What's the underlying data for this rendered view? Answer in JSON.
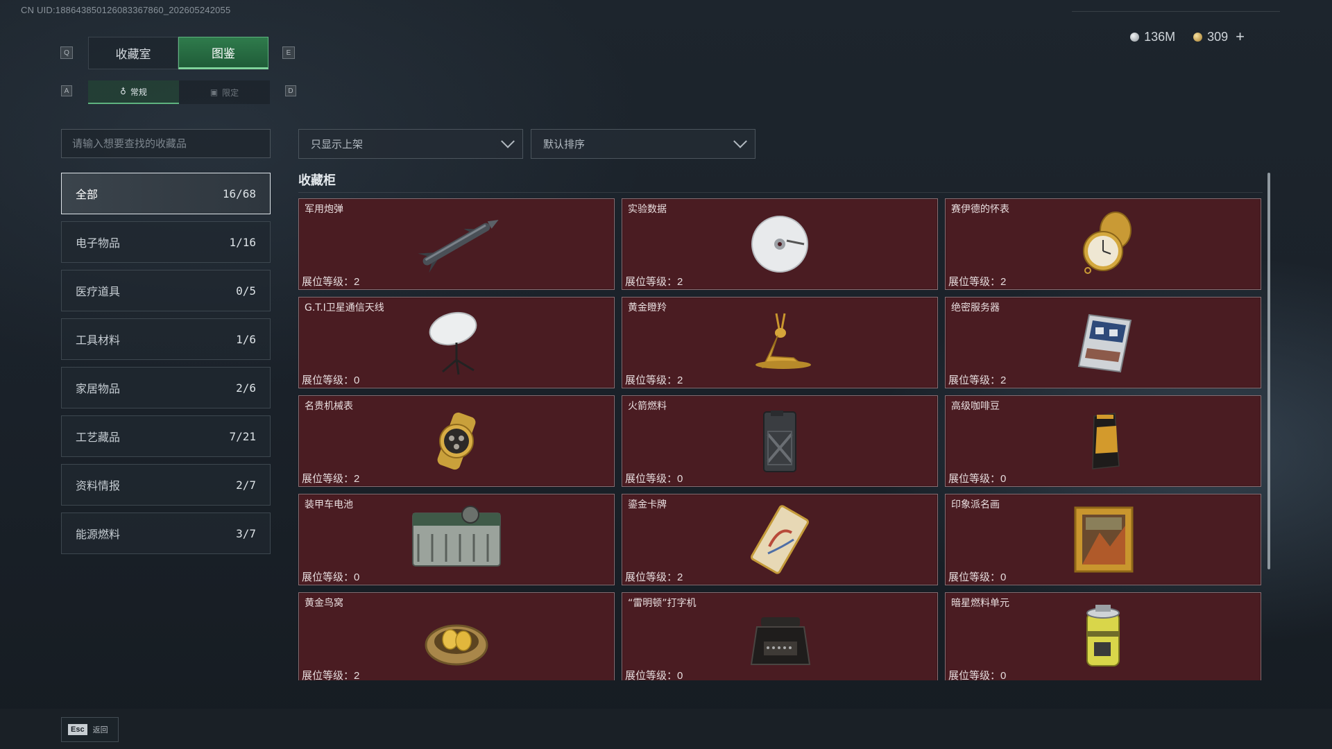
{
  "uid": "CN UID:188643850126083367860_202605242055",
  "currency": {
    "silver": "136M",
    "gold": "309",
    "plus": "+"
  },
  "keys": {
    "q": "Q",
    "e": "E",
    "a": "A",
    "d": "D"
  },
  "tabs": [
    "收藏室",
    "图鉴"
  ],
  "subtabs": [
    "常规",
    "限定"
  ],
  "search": {
    "placeholder": "请输入想要查找的收藏品"
  },
  "filters": {
    "show": "只显示上架",
    "sort": "默认排序"
  },
  "categories": [
    {
      "label": "全部",
      "count": "16/68"
    },
    {
      "label": "电子物品",
      "count": "1/16"
    },
    {
      "label": "医疗道具",
      "count": "0/5"
    },
    {
      "label": "工具材料",
      "count": "1/6"
    },
    {
      "label": "家居物品",
      "count": "2/6"
    },
    {
      "label": "工艺藏品",
      "count": "7/21"
    },
    {
      "label": "资料情报",
      "count": "2/7"
    },
    {
      "label": "能源燃料",
      "count": "3/7"
    }
  ],
  "section_title": "收藏柜",
  "level_label": "展位等级：",
  "items": [
    {
      "name": "军用炮弹",
      "level": "2",
      "icon": "missile-icon"
    },
    {
      "name": "实验数据",
      "level": "2",
      "icon": "disc-icon"
    },
    {
      "name": "赛伊德的怀表",
      "level": "2",
      "icon": "pocket-watch-icon"
    },
    {
      "name": "G.T.I卫星通信天线",
      "level": "0",
      "icon": "satellite-dish-icon"
    },
    {
      "name": "黄金瞪羚",
      "level": "2",
      "icon": "gold-gazelle-icon"
    },
    {
      "name": "绝密服务器",
      "level": "2",
      "icon": "server-icon"
    },
    {
      "name": "名贵机械表",
      "level": "2",
      "icon": "wristwatch-icon"
    },
    {
      "name": "火箭燃料",
      "level": "0",
      "icon": "fuel-canister-icon"
    },
    {
      "name": "高级咖啡豆",
      "level": "0",
      "icon": "coffee-bag-icon"
    },
    {
      "name": "装甲车电池",
      "level": "0",
      "icon": "battery-icon"
    },
    {
      "name": "鎏金卡牌",
      "level": "2",
      "icon": "gilded-card-icon"
    },
    {
      "name": "印象派名画",
      "level": "0",
      "icon": "painting-icon"
    },
    {
      "name": "黄金鸟窝",
      "level": "2",
      "icon": "golden-nest-icon"
    },
    {
      "name": "“雷明顿”打字机",
      "level": "0",
      "icon": "typewriter-icon"
    },
    {
      "name": "暗星燃料单元",
      "level": "0",
      "icon": "fuel-cell-icon"
    }
  ],
  "esc": {
    "key": "Esc",
    "label": "返回"
  }
}
